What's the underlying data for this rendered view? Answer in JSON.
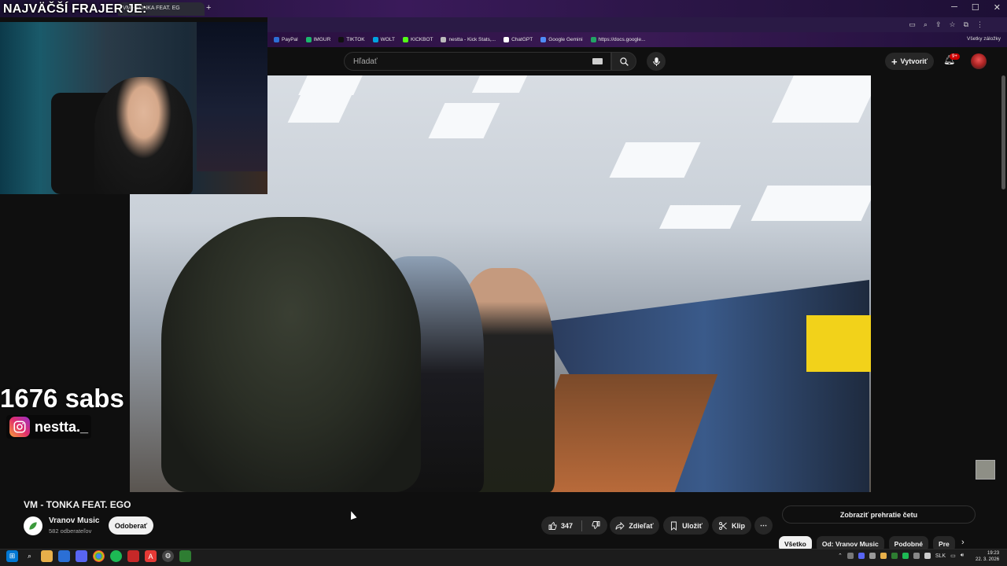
{
  "browser": {
    "active_tab_title": "VM - TONKA FEAT. EG",
    "bookmarks": [
      {
        "label": "PayPal",
        "color": "#2d6fd6"
      },
      {
        "label": "IMGUR",
        "color": "#1bb76e"
      },
      {
        "label": "TIKTOK",
        "color": "#111111"
      },
      {
        "label": "WOLT",
        "color": "#00a3e0"
      },
      {
        "label": "KICKBOT",
        "color": "#53fc18"
      },
      {
        "label": "nestta - Kick Stats,...",
        "color": "#bbbbbb"
      },
      {
        "label": "ChatGPT",
        "color": "#ffffff"
      },
      {
        "label": "Google Gemini",
        "color": "#4f8cf7"
      },
      {
        "label": "https://docs.google...",
        "color": "#22a565"
      }
    ],
    "all_bookmarks_label": "Všetky záložky"
  },
  "youtube": {
    "search_placeholder": "Hľadať",
    "create_label": "Vytvoriť",
    "notification_count": "9+",
    "video": {
      "title": "VM - TONKA FEAT. EGO",
      "channel_name": "Vranov Music",
      "subscribers": "582 odberateľov",
      "subscribe_label": "Odoberať",
      "likes": "347",
      "share_label": "Zdieľať",
      "save_label": "Uložiť",
      "clip_label": "Klip"
    },
    "chat_replay_label": "Zobraziť prehratie četu",
    "chips": [
      "Všetko",
      "Od: Vranov Music",
      "Podobné",
      "Pre"
    ]
  },
  "stream_overlay": {
    "title": "NAJVÄČŠÍ FRAJER JE:",
    "sub_count": "1676 sabs",
    "instagram_handle": "nestta._"
  },
  "taskbar": {
    "language": "SLK",
    "time": "19:23",
    "date": "22. 3. 2026"
  },
  "colors": {
    "youtube_bg": "#0f0f0f",
    "pill_bg": "#272727",
    "notification_red": "#cc0000"
  }
}
